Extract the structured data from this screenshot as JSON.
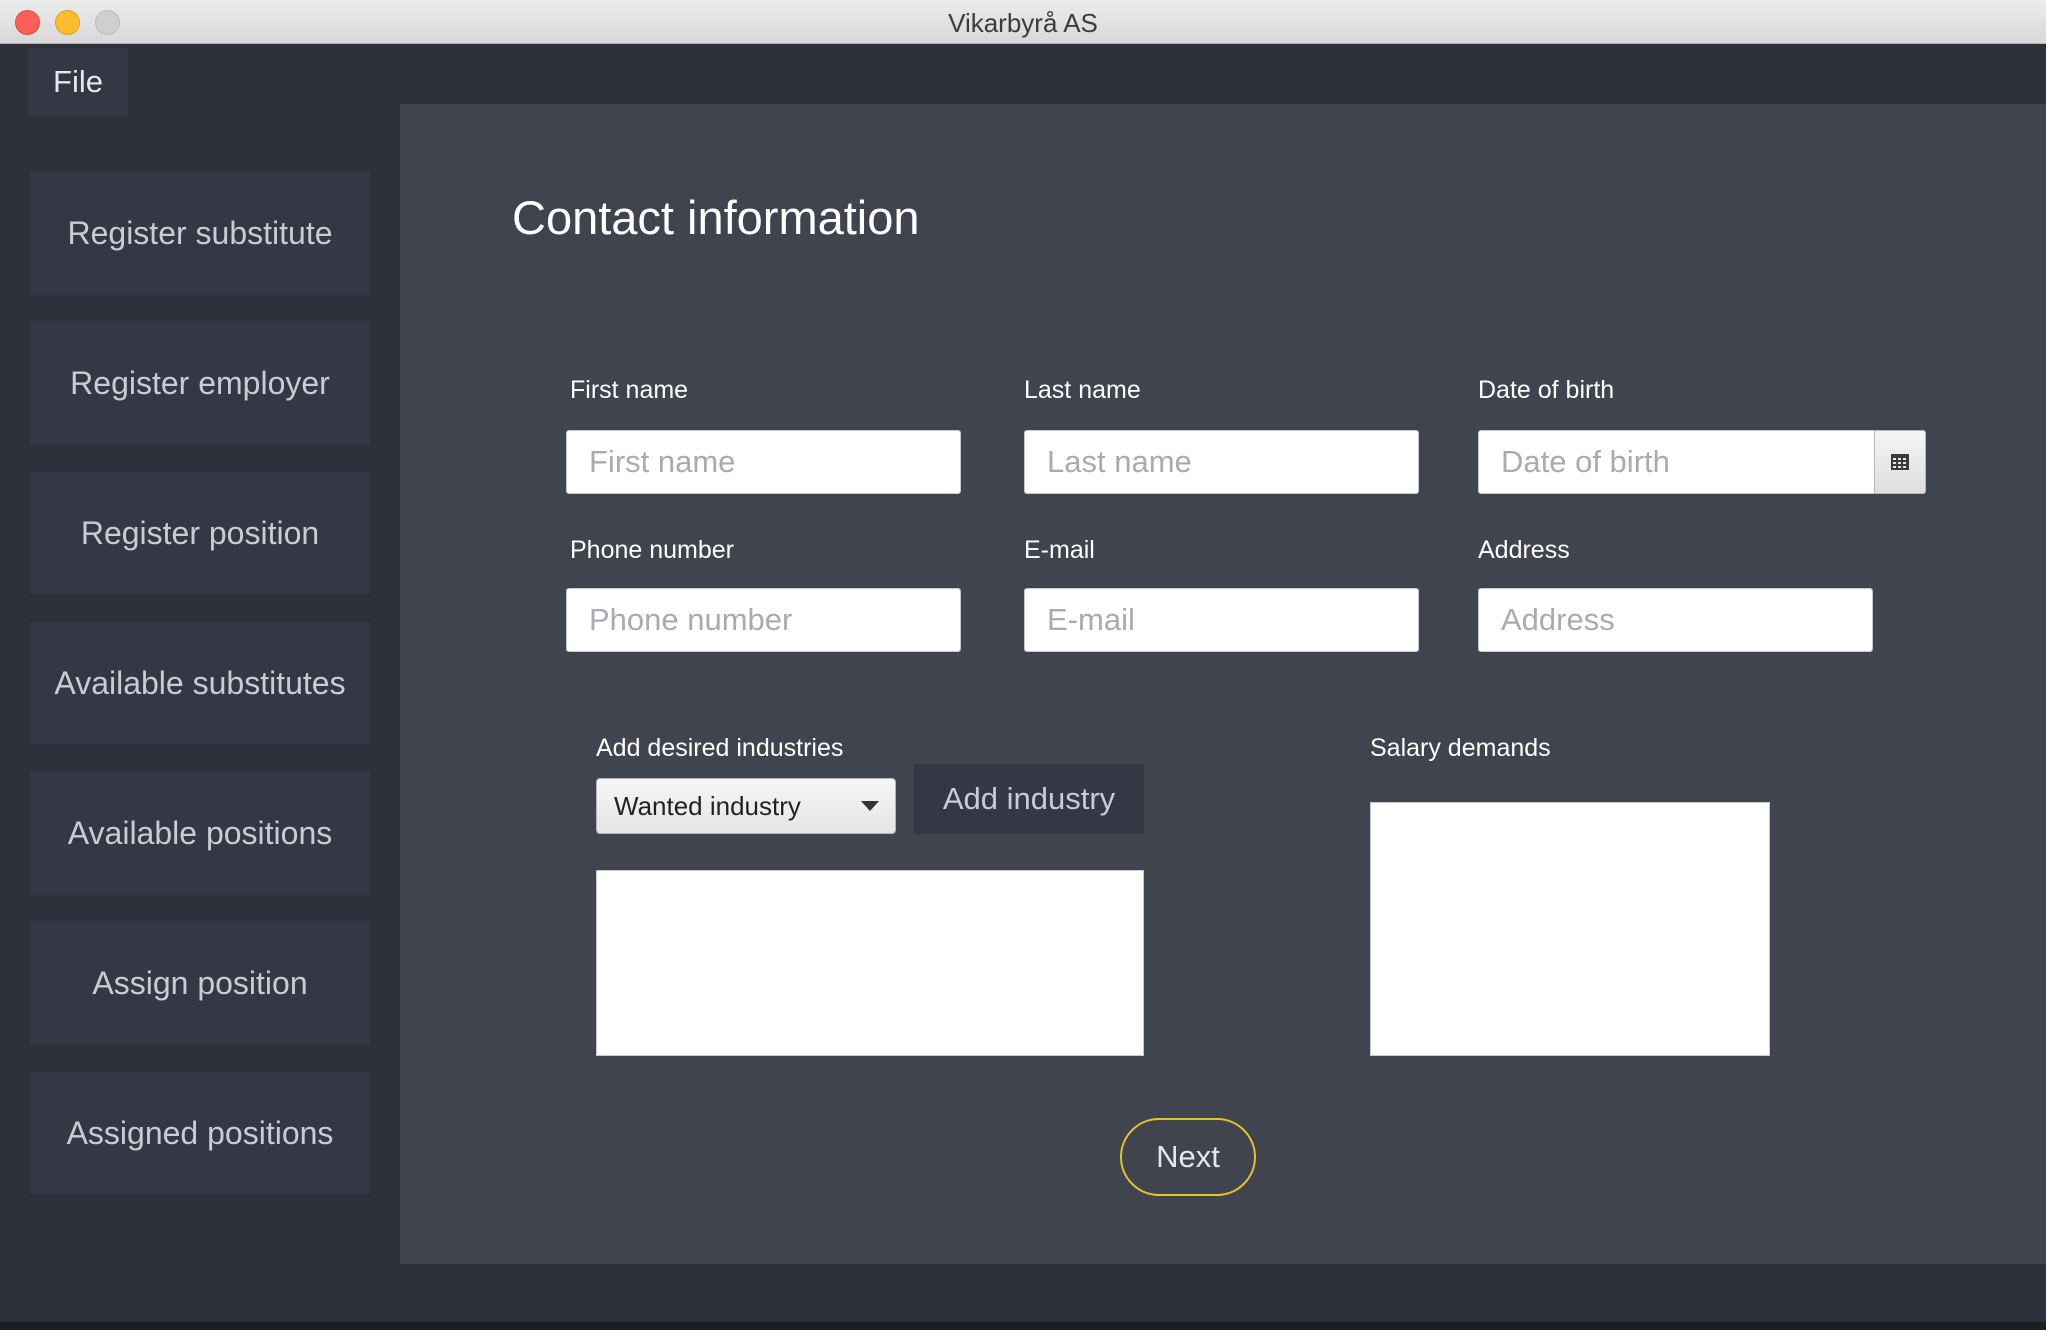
{
  "window": {
    "title": "Vikarbyrå AS"
  },
  "menu": {
    "file_label": "File"
  },
  "sidebar": {
    "items": [
      {
        "label": "Register substitute"
      },
      {
        "label": "Register employer"
      },
      {
        "label": "Register position"
      },
      {
        "label": "Available substitutes"
      },
      {
        "label": "Available positions"
      },
      {
        "label": "Assign position"
      },
      {
        "label": "Assigned positions"
      }
    ]
  },
  "form": {
    "title": "Contact information",
    "first_name": {
      "label": "First name",
      "placeholder": "First name",
      "value": ""
    },
    "last_name": {
      "label": "Last name",
      "placeholder": "Last name",
      "value": ""
    },
    "date_of_birth": {
      "label": "Date of birth",
      "placeholder": "Date of birth",
      "value": "",
      "icon": "calendar-icon"
    },
    "phone": {
      "label": "Phone number",
      "placeholder": "Phone number",
      "value": ""
    },
    "email": {
      "label": "E-mail",
      "placeholder": "E-mail",
      "value": ""
    },
    "address": {
      "label": "Address",
      "placeholder": "Address",
      "value": ""
    },
    "industries": {
      "label": "Add desired industries",
      "select_value": "Wanted industry",
      "add_button": "Add industry",
      "list_items": []
    },
    "salary": {
      "label": "Salary demands",
      "value": ""
    },
    "next_button": "Next"
  },
  "colors": {
    "background": "#2e313b",
    "panel": "#40444f",
    "button": "#343844",
    "accent": "#e8c42a"
  }
}
